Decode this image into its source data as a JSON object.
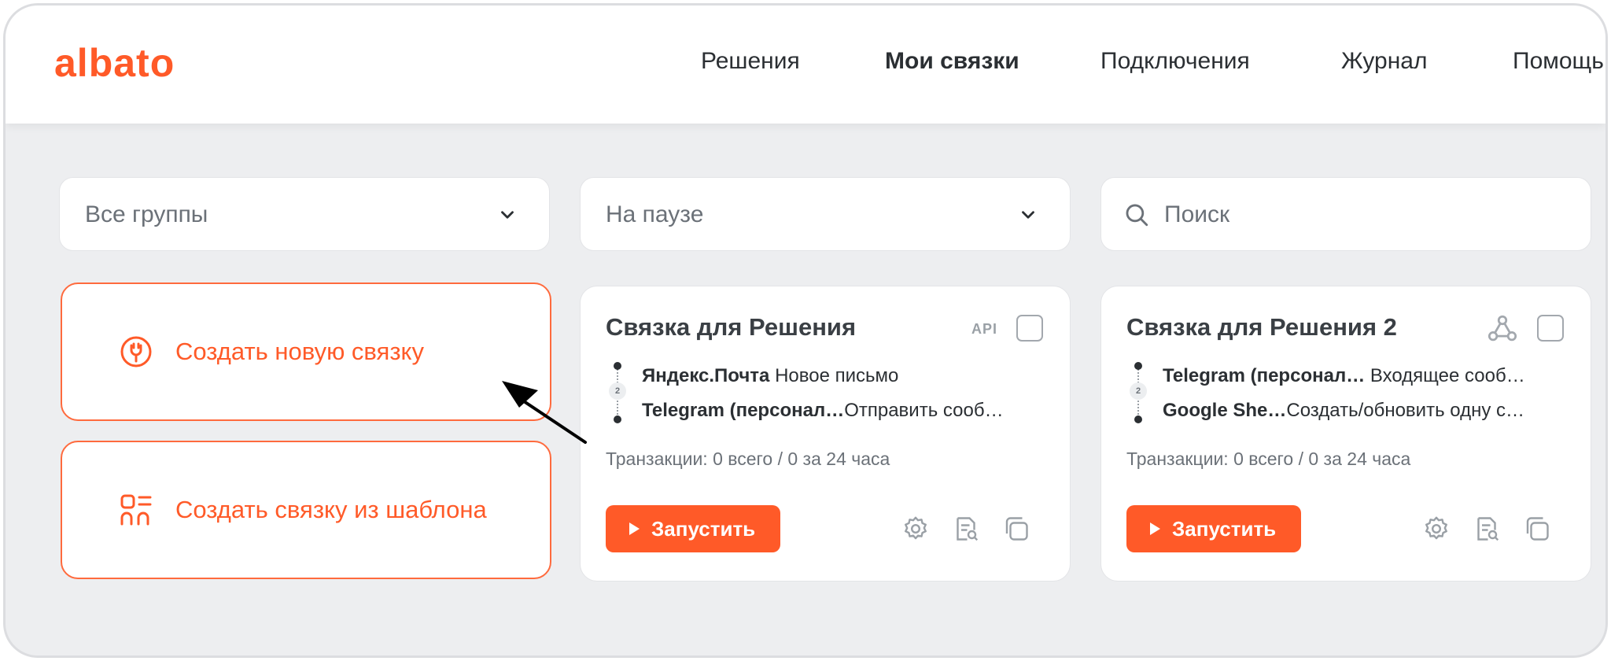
{
  "header": {
    "logo": "albato",
    "nav": [
      "Решения",
      "Мои связки",
      "Подключения",
      "Журнал",
      "Помощь"
    ],
    "active": "Мои связки"
  },
  "filters": {
    "groups": "Все группы",
    "status": "На паузе",
    "search_placeholder": "Поиск"
  },
  "actions": {
    "create_new": "Создать новую связку",
    "create_template": "Создать связку из шаблона"
  },
  "bundles": [
    {
      "title": "Связка для Решения",
      "badge": "API",
      "step1_app": "Яндекс.Почта",
      "step1_action": "Новое письмо",
      "step2_app": "Telegram (персонал…",
      "step2_action": "Отправить сооб…",
      "step_number": "2",
      "transactions": "Транзакции: 0 всего / 0 за 24 часа",
      "run_label": "Запустить"
    },
    {
      "title": "Связка для Решения 2",
      "badge_icon": "webhook-icon",
      "step1_app": "Telegram (персонал…",
      "step1_action": "Входящее сооб…",
      "step2_app": "Google She…",
      "step2_action": "Создать/обновить одну с…",
      "step_number": "2",
      "transactions": "Транзакции: 0 всего / 0 за 24 часа",
      "run_label": "Запустить"
    }
  ],
  "colors": {
    "accent": "#ff5a28",
    "background": "#edeef0",
    "text": "#2b2f33",
    "muted": "#6b7178"
  }
}
